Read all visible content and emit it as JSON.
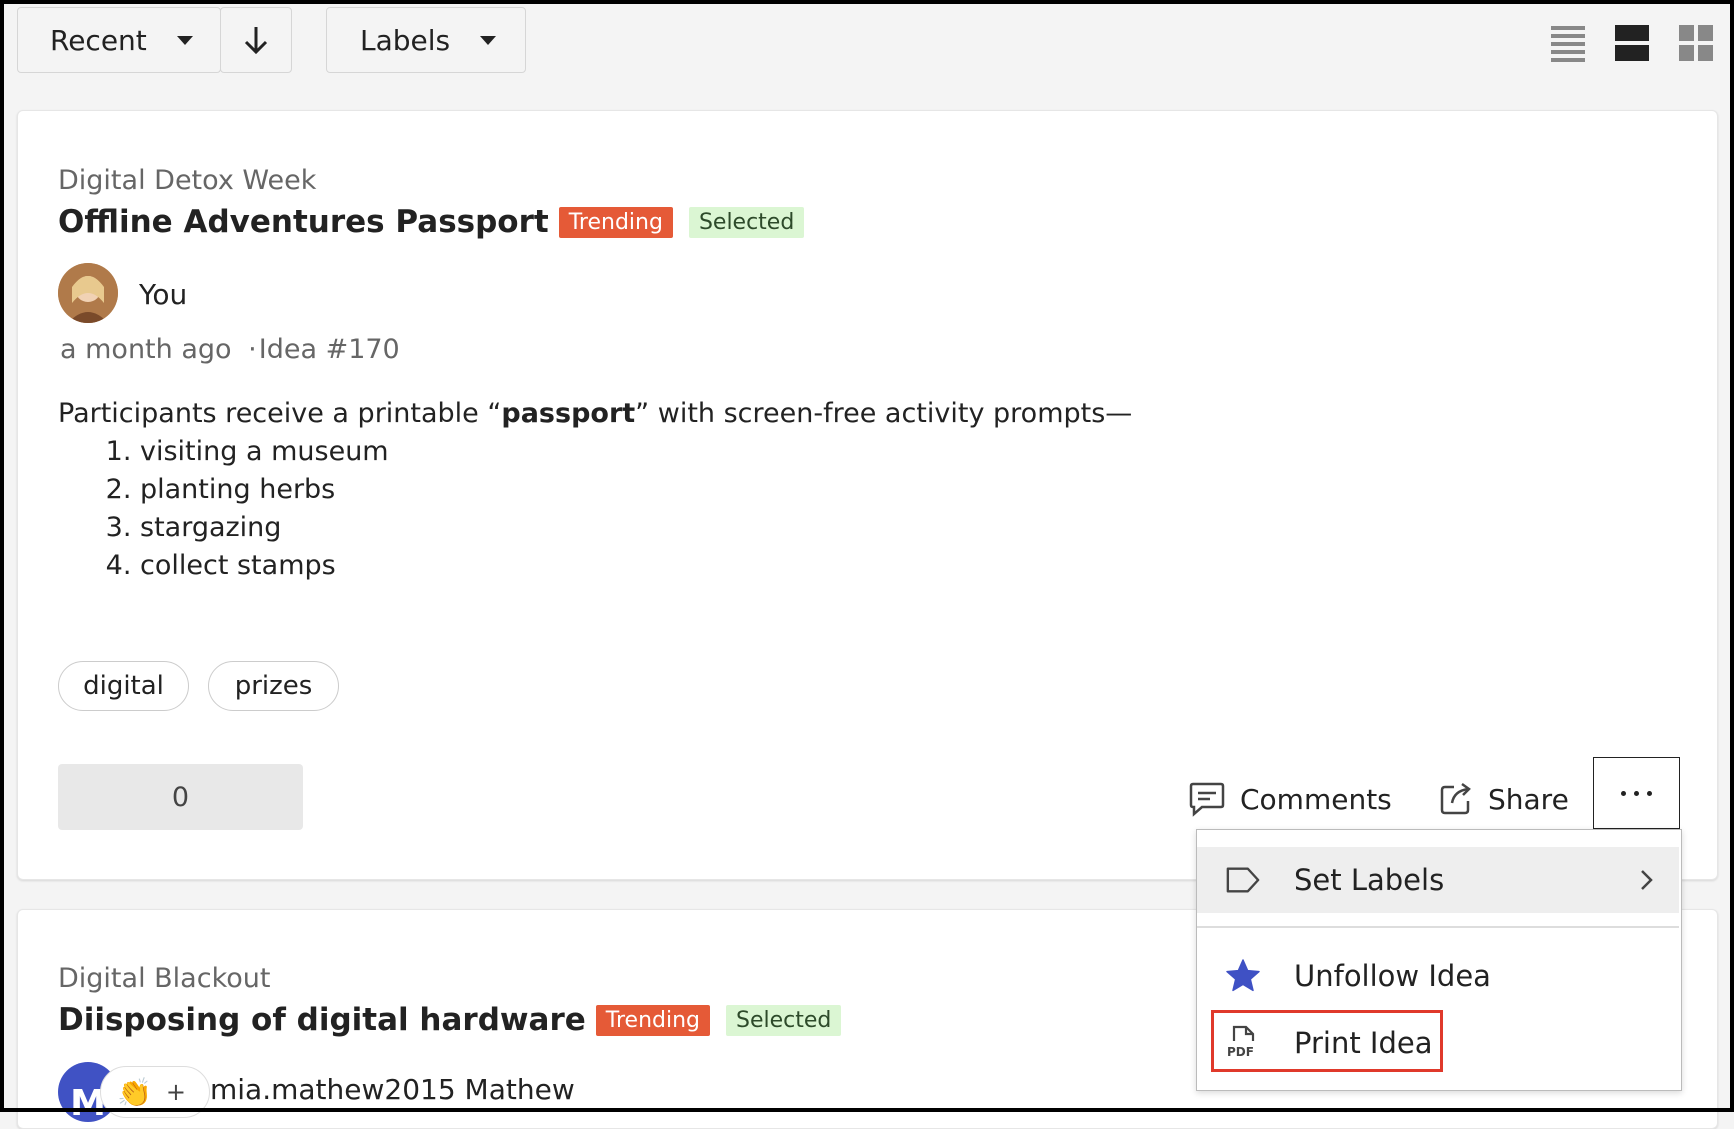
{
  "toolbar": {
    "sort_label": "Recent",
    "labels_label": "Labels"
  },
  "ideas": [
    {
      "campaign": "Digital Detox Week",
      "title": "Offline Adventures Passport",
      "badge_trending": "Trending",
      "badge_selected": "Selected",
      "author": "You",
      "time": "a month ago",
      "separator": "·",
      "idea_number": "Idea #170",
      "description_before": "Participants receive a printable “",
      "description_bold": "passport",
      "description_after": "” with screen-free activity prompts—",
      "list": [
        "visiting a museum",
        "planting herbs",
        "stargazing",
        "collect stamps"
      ],
      "tags": [
        "digital",
        "prizes"
      ],
      "votes": "0",
      "comments_label": "Comments",
      "share_label": "Share"
    },
    {
      "campaign": "Digital Blackout",
      "title": "Diisposing of digital hardware",
      "badge_trending": "Trending",
      "badge_selected": "Selected",
      "avatar_initial": "M",
      "reaction_emoji": "👏",
      "reaction_add": "+",
      "author": "mia.mathew2015 Mathew"
    }
  ],
  "menu": {
    "set_labels": "Set Labels",
    "unfollow": "Unfollow Idea",
    "print": "Print Idea",
    "pdf_icon_text": "PDF"
  },
  "colors": {
    "trending": "#e55a37",
    "selected_bg": "#dbf6d3",
    "star": "#3f51c4",
    "highlight": "#e0392b",
    "avatar_blue": "#4052c4"
  }
}
